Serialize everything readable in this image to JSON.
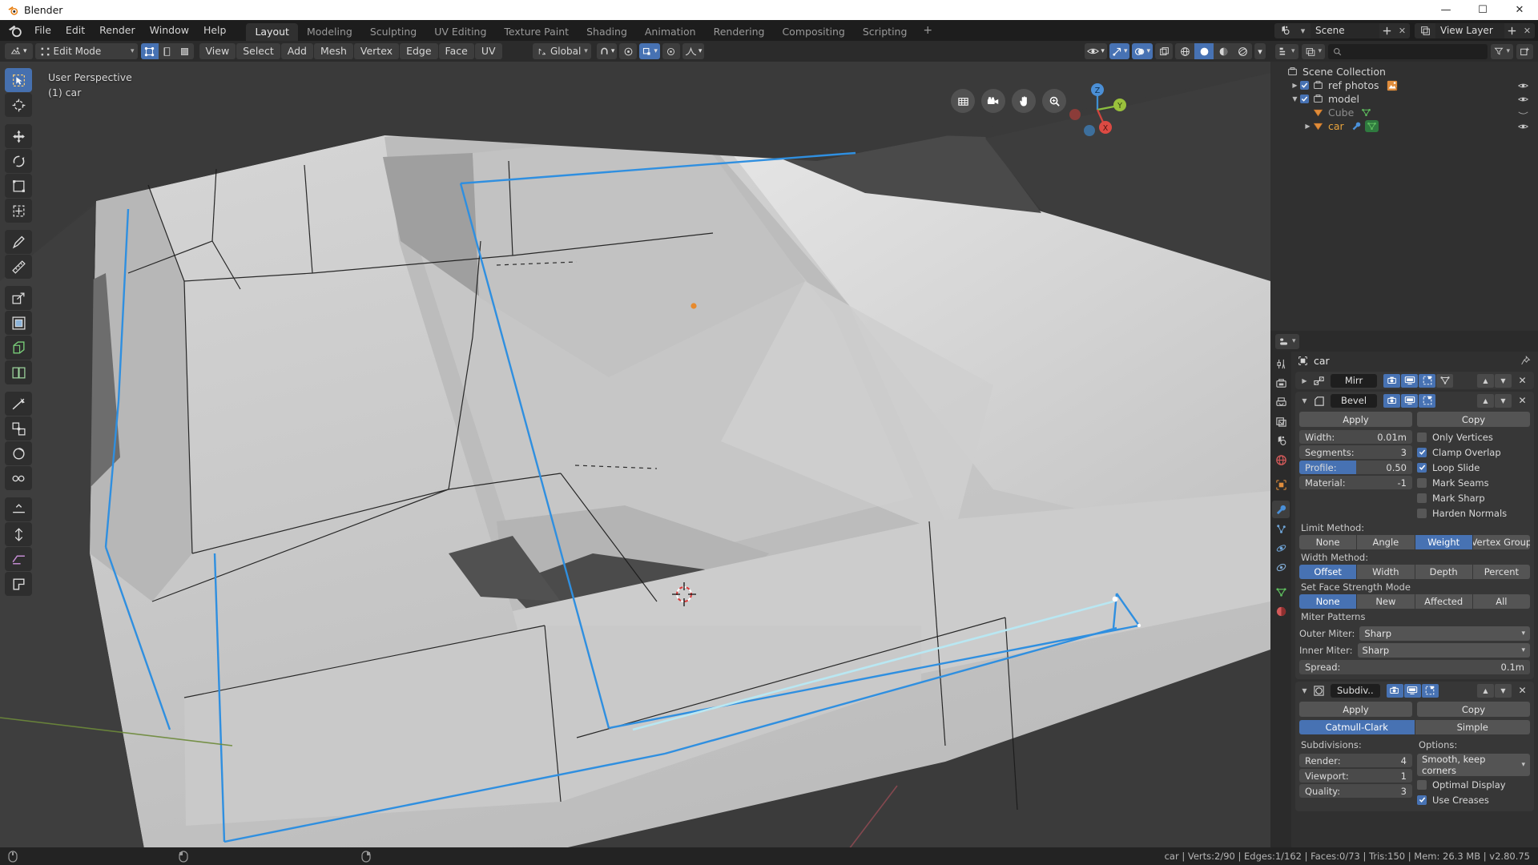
{
  "window": {
    "title": "Blender",
    "buttons": {
      "minimize": "—",
      "maximize": "☐",
      "close": "✕"
    }
  },
  "topbar": {
    "menus": [
      "File",
      "Edit",
      "Render",
      "Window",
      "Help"
    ],
    "workspaces": [
      "Layout",
      "Modeling",
      "Sculpting",
      "UV Editing",
      "Texture Paint",
      "Shading",
      "Animation",
      "Rendering",
      "Compositing",
      "Scripting"
    ],
    "active_workspace": "Layout",
    "add_workspace": "+",
    "scene_name": "Scene",
    "view_layer_name": "View Layer",
    "scene_icon": "scene-icon",
    "view_layer_icon": "view-layer-icon",
    "new_icon": "new-icon",
    "unlink_icon": "unlink-icon"
  },
  "viewport": {
    "mode_selector": "Edit Mode",
    "editor_type_icon": "editor-type-icon",
    "select_modes": [
      "vertex-select-icon",
      "edge-select-icon",
      "face-select-icon"
    ],
    "active_select_mode": 0,
    "menus": [
      "View",
      "Select",
      "Add",
      "Mesh",
      "Vertex",
      "Edge",
      "Face",
      "UV"
    ],
    "transform_orientation": "Global",
    "snap_icon": "magnet-icon",
    "pivot_icon": "pivot-icon",
    "proportional_icon": "proportional-edit-icon",
    "falloff_icon": "falloff-curve-icon",
    "overlay_text_line1": "User Perspective",
    "overlay_text_line2": "(1) car",
    "tools": [
      "tweak-select-tool",
      "cursor-tool",
      "move-tool",
      "rotate-tool",
      "scale-tool",
      "transform-tool",
      "annotate-tool",
      "measure-tool",
      "extrude-region-tool",
      "inset-faces-tool",
      "bevel-tool",
      "loop-cut-tool",
      "knife-tool",
      "poly-build-tool",
      "spin-tool",
      "smooth-tool",
      "edge-slide-tool",
      "shrink-fatten-tool",
      "shear-tool",
      "rip-region-tool"
    ],
    "active_tool_index": 0,
    "nav_gizmos": [
      "toggle-orthographic-icon",
      "camera-view-icon",
      "pan-view-icon",
      "zoom-view-icon"
    ],
    "axis_labels": {
      "x": "X",
      "y": "Y",
      "z": "Z"
    },
    "header_right_icons": [
      "visibility-selector-icon",
      "show-gizmo-icon",
      "show-overlays-icon",
      "toggle-xray-icon",
      "shading-wireframe-icon",
      "shading-solid-icon",
      "shading-material-icon",
      "shading-rendered-icon"
    ]
  },
  "outliner": {
    "display_mode_icon": "outliner-display-mode-icon",
    "filter_id_icon": "filter-id-icon",
    "search_placeholder": "",
    "search_icon": "search-icon",
    "filter_icon": "filter-icon",
    "new_collection_icon": "new-collection-icon",
    "rows": [
      {
        "label": "Scene Collection",
        "indent": 0,
        "icon": "collection-icon",
        "disclosure": "",
        "checkbox": null,
        "badges": [],
        "eye": false,
        "style": "normal"
      },
      {
        "label": "ref photos",
        "indent": 1,
        "icon": "collection-icon",
        "disclosure": "▶",
        "checkbox": true,
        "badges": [
          "image-icon"
        ],
        "eye": true,
        "style": "normal"
      },
      {
        "label": "model",
        "indent": 1,
        "icon": "collection-icon",
        "disclosure": "▼",
        "checkbox": true,
        "badges": [],
        "eye": true,
        "style": "normal"
      },
      {
        "label": "Cube",
        "indent": 2,
        "icon": "mesh-object-icon",
        "disclosure": "",
        "checkbox": null,
        "badges": [
          "mesh-data-icon"
        ],
        "eye": "closed",
        "style": "dim"
      },
      {
        "label": "car",
        "indent": 2,
        "icon": "mesh-object-icon",
        "disclosure": "▶",
        "checkbox": null,
        "badges": [
          "modifier-wrench-icon",
          "mesh-data-icon"
        ],
        "eye": true,
        "style": "selected"
      }
    ]
  },
  "properties": {
    "editor_type_icon": "properties-editor-icon",
    "breadcrumb_icon": "object-icon",
    "breadcrumb": "car",
    "pin_icon": "pin-icon",
    "tabs": [
      "tool-icon",
      "render-icon",
      "output-icon",
      "view-layer-icon",
      "scene-icon",
      "world-icon",
      "object-icon",
      "modifier-wrench-icon",
      "particles-icon",
      "physics-icon",
      "constraints-icon",
      "object-data-icon",
      "material-icon"
    ],
    "active_tab_index": 7,
    "modifiers": [
      {
        "id": "mirror",
        "name": "Mirr",
        "icon": "mirror-modifier-icon",
        "expanded": false,
        "display_toggles": [
          {
            "icon": "render-toggle-icon",
            "on": true
          },
          {
            "icon": "realtime-toggle-icon",
            "on": true
          },
          {
            "icon": "edit-mode-toggle-icon",
            "on": true
          },
          {
            "icon": "on-cage-toggle-icon",
            "on": false
          }
        ],
        "move_up": "▲",
        "move_down": "▼",
        "close": "✕"
      },
      {
        "id": "bevel",
        "name": "Bevel",
        "icon": "bevel-modifier-icon",
        "expanded": true,
        "display_toggles": [
          {
            "icon": "render-toggle-icon",
            "on": true
          },
          {
            "icon": "realtime-toggle-icon",
            "on": true
          },
          {
            "icon": "edit-mode-toggle-icon",
            "on": true
          }
        ],
        "move_up": "▲",
        "move_down": "▼",
        "close": "✕",
        "apply_label": "Apply",
        "copy_label": "Copy",
        "fields": [
          {
            "label": "Width:",
            "value": "0.01m",
            "fill": 0
          },
          {
            "label": "Segments:",
            "value": "3",
            "fill": 0
          },
          {
            "label": "Profile:",
            "value": "0.50",
            "fill": 50
          },
          {
            "label": "Material:",
            "value": "-1",
            "fill": 0
          }
        ],
        "checkboxes": [
          {
            "label": "Only Vertices",
            "checked": false
          },
          {
            "label": "Clamp Overlap",
            "checked": true
          },
          {
            "label": "Loop Slide",
            "checked": true
          },
          {
            "label": "Mark Seams",
            "checked": false
          },
          {
            "label": "Mark Sharp",
            "checked": false
          },
          {
            "label": "Harden Normals",
            "checked": false
          }
        ],
        "limit_method_label": "Limit Method:",
        "limit_method_options": [
          "None",
          "Angle",
          "Weight",
          "Vertex Group"
        ],
        "limit_method_active": "Weight",
        "width_method_label": "Width Method:",
        "width_method_options": [
          "Offset",
          "Width",
          "Depth",
          "Percent"
        ],
        "width_method_active": "Offset",
        "face_strength_label": "Set Face Strength Mode",
        "face_strength_options": [
          "None",
          "New",
          "Affected",
          "All"
        ],
        "face_strength_active": "None",
        "miter_label": "Miter Patterns",
        "outer_miter_label": "Outer Miter:",
        "outer_miter_value": "Sharp",
        "inner_miter_label": "Inner Miter:",
        "inner_miter_value": "Sharp",
        "spread_label": "Spread:",
        "spread_value": "0.1m"
      },
      {
        "id": "subsurf",
        "name": "Subdiv..",
        "icon": "subsurf-modifier-icon",
        "expanded": true,
        "display_toggles": [
          {
            "icon": "render-toggle-icon",
            "on": true
          },
          {
            "icon": "realtime-toggle-icon",
            "on": true
          },
          {
            "icon": "edit-mode-toggle-icon",
            "on": true
          }
        ],
        "move_up": "▲",
        "move_down": "▼",
        "close": "✕",
        "apply_label": "Apply",
        "copy_label": "Copy",
        "algorithm_options": [
          "Catmull-Clark",
          "Simple"
        ],
        "algorithm_active": "Catmull-Clark",
        "subdivisions_label": "Subdivisions:",
        "options_label": "Options:",
        "fields": [
          {
            "label": "Render:",
            "value": "4"
          },
          {
            "label": "Viewport:",
            "value": "1"
          },
          {
            "label": "Quality:",
            "value": "3"
          }
        ],
        "uv_smooth_value": "Smooth, keep corners",
        "checkboxes": [
          {
            "label": "Optimal Display",
            "checked": false
          },
          {
            "label": "Use Creases",
            "checked": true
          }
        ]
      }
    ]
  },
  "statusbar": {
    "info": "car | Verts:2/90 | Edges:1/162 | Faces:0/73 | Tris:150 | Mem: 26.3 MB | v2.80.75"
  }
}
